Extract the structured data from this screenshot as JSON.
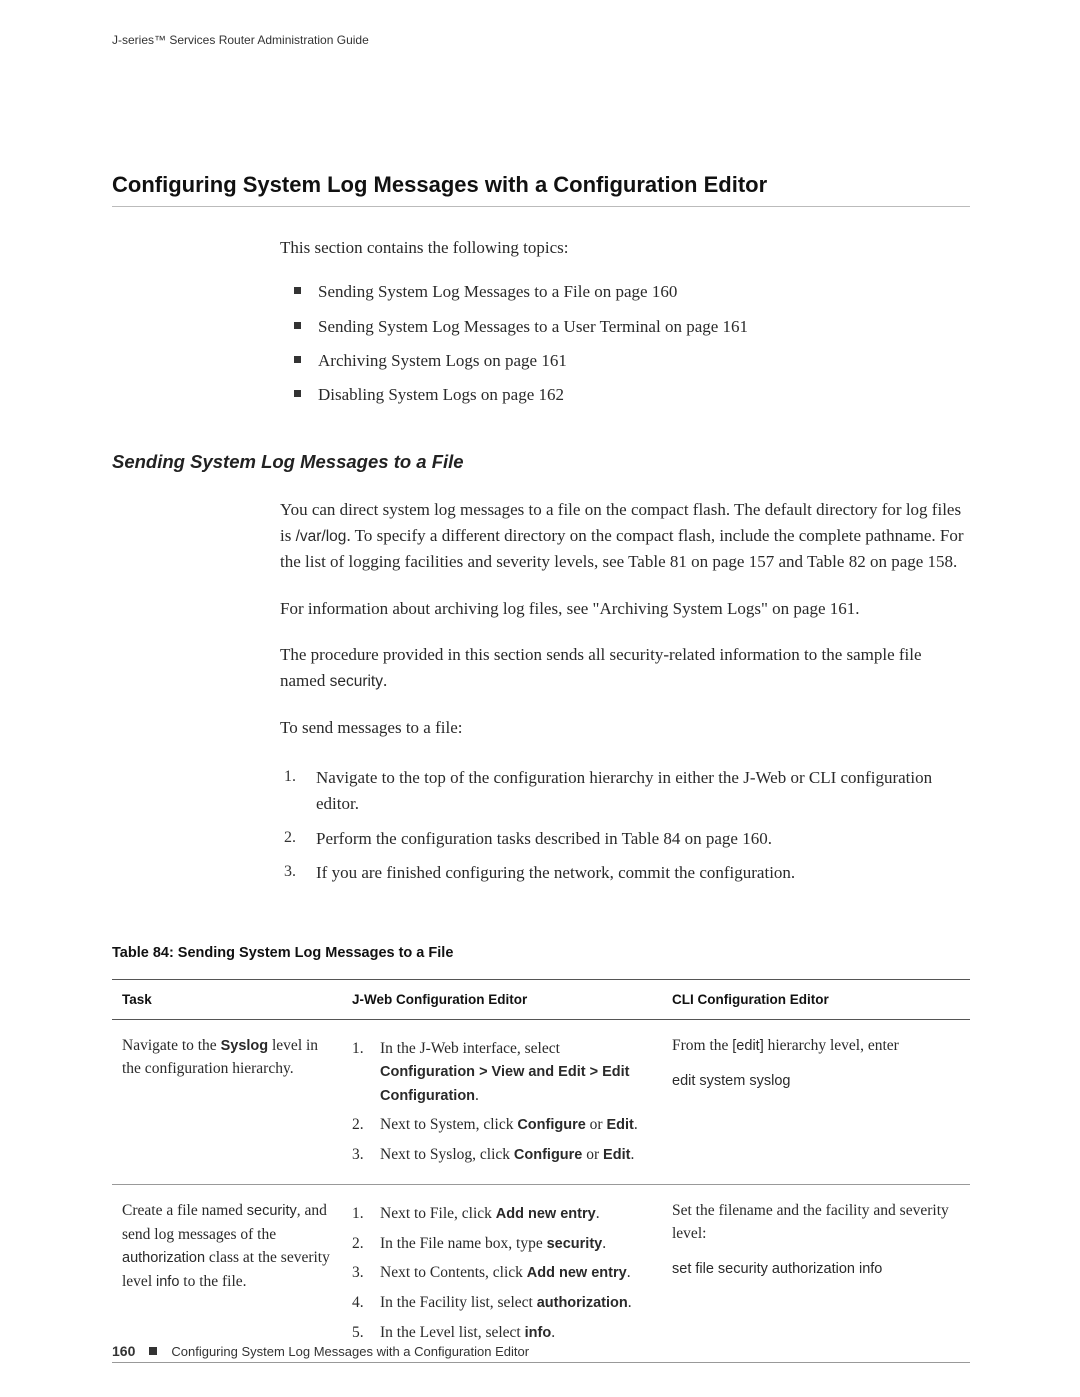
{
  "running_head": "J-series™ Services Router Administration Guide",
  "section_title": "Configuring System Log Messages with a Configuration Editor",
  "intro": "This section contains the following topics:",
  "topics": [
    "Sending System Log Messages to a File on page 160",
    "Sending System Log Messages to a User Terminal on page 161",
    "Archiving System Logs on page 161",
    "Disabling System Logs on page 162"
  ],
  "subheading": "Sending System Log Messages to a File",
  "para1_a": "You can direct system log messages to a file on the compact flash. The default directory for log files is ",
  "para1_path": "/var/log",
  "para1_b": ". To specify a different directory on the compact flash, include the complete pathname. For the list of logging facilities and severity levels, see Table 81 on page 157 and Table 82 on page 158.",
  "para2": "For information about archiving log files, see \"Archiving System Logs\" on page 161.",
  "para3_a": "The procedure provided in this section sends all security-related information to the sample file named ",
  "para3_file": "security",
  "para3_b": ".",
  "para4": "To send messages to a file:",
  "steps": [
    "Navigate to the top of the configuration hierarchy in either the J-Web or CLI configuration editor.",
    "Perform the configuration tasks described in Table 84 on page 160.",
    "If you are finished configuring the network, commit the configuration."
  ],
  "table_caption": "Table 84: Sending System Log Messages to a File",
  "thead": {
    "task": "Task",
    "jweb": "J-Web Configuration Editor",
    "cli": "CLI Configuration Editor"
  },
  "row1": {
    "task_a": "Navigate to the ",
    "task_bold": "Syslog",
    "task_b": " level in the configuration hierarchy.",
    "j1_a": "In the J-Web interface, select ",
    "j1_b": "Configuration > View and Edit > Edit Configuration",
    "j1_c": ".",
    "j2_a": "Next to System, click ",
    "j2_b": "Configure",
    "j2_c": " or ",
    "j2_d": "Edit",
    "j2_e": ".",
    "j3_a": "Next to Syslog, click ",
    "j3_b": "Configure",
    "j3_c": " or ",
    "j3_d": "Edit",
    "j3_e": ".",
    "cli_a": "From the ",
    "cli_b": "[edit]",
    "cli_c": " hierarchy level, enter",
    "cli_cmd": "edit system syslog"
  },
  "row2": {
    "task_a": "Create a file named ",
    "task_sec": "security",
    "task_b": ", and send log messages of the ",
    "task_auth": "authorization",
    "task_c": " class at the severity level ",
    "task_info": "info",
    "task_d": " to the file.",
    "j1_a": "Next to File, click ",
    "j1_b": "Add new entry",
    "j1_c": ".",
    "j2_a": "In the File name box, type ",
    "j2_b": "security",
    "j2_c": ".",
    "j3_a": "Next to Contents, click ",
    "j3_b": "Add new entry",
    "j3_c": ".",
    "j4_a": "In the Facility list, select ",
    "j4_b": "authorization",
    "j4_c": ".",
    "j5_a": "In the Level list, select ",
    "j5_b": "info",
    "j5_c": ".",
    "cli_a": "Set the filename and the facility and severity level:",
    "cli_cmd": "set file security authorization info"
  },
  "footer": {
    "page": "160",
    "text": "Configuring System Log Messages with a Configuration Editor"
  }
}
